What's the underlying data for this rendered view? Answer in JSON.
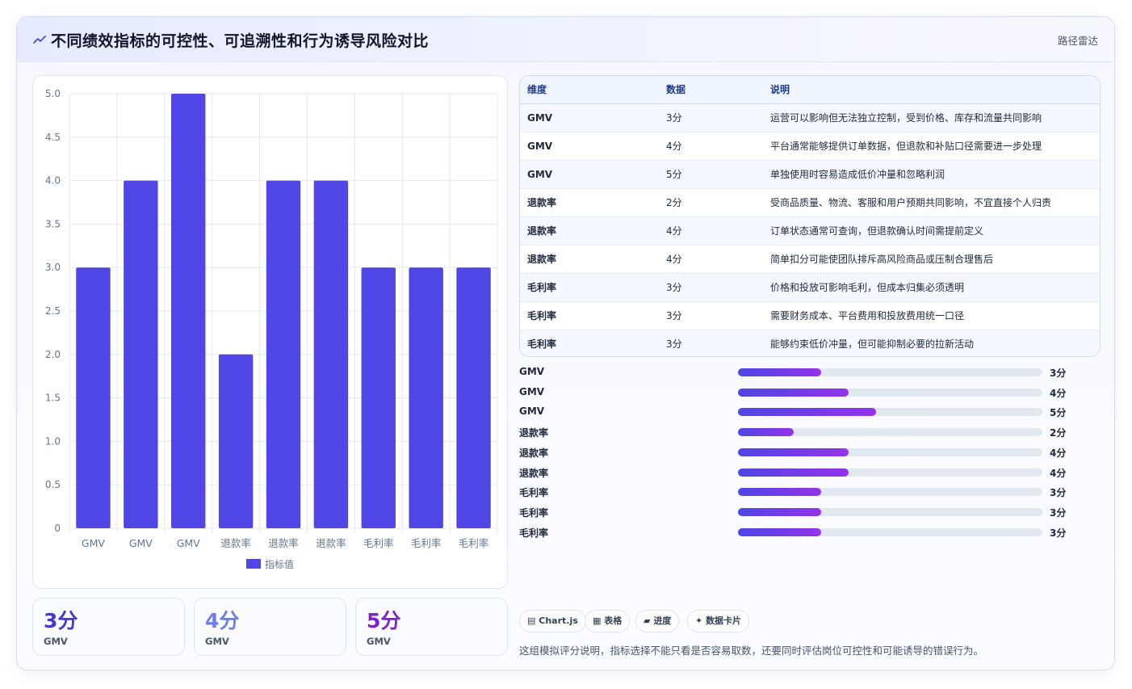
{
  "header": {
    "title": "不同绩效指标的可控性、可追溯性和行为诱导风险对比",
    "tag": "路径雷达"
  },
  "colors": {
    "bar": "#4f46e5",
    "stat": [
      "#4338ca",
      "#6d7fe6",
      "#7e22ce"
    ]
  },
  "chart_data": {
    "type": "bar",
    "categories": [
      "GMV",
      "GMV",
      "GMV",
      "退款率",
      "退款率",
      "退款率",
      "毛利率",
      "毛利率",
      "毛利率"
    ],
    "series": [
      {
        "name": "指标值",
        "values": [
          3,
          4,
          5,
          2,
          4,
          4,
          3,
          3,
          3
        ]
      }
    ],
    "ylim": [
      0,
      5
    ],
    "yticks": [
      "0",
      "0.5",
      "1.0",
      "1.5",
      "2.0",
      "2.5",
      "3.0",
      "3.5",
      "4.0",
      "4.5",
      "5.0"
    ],
    "grid": true,
    "legend": "bottom"
  },
  "stats": [
    {
      "value": "3分",
      "label": "GMV"
    },
    {
      "value": "4分",
      "label": "GMV"
    },
    {
      "value": "5分",
      "label": "GMV"
    }
  ],
  "table": {
    "headers": [
      "维度",
      "数据",
      "说明"
    ],
    "rows": [
      {
        "dim": "GMV",
        "score": "3分",
        "note": "运营可以影响但无法独立控制，受到价格、库存和流量共同影响"
      },
      {
        "dim": "GMV",
        "score": "4分",
        "note": "平台通常能够提供订单数据，但退款和补贴口径需要进一步处理"
      },
      {
        "dim": "GMV",
        "score": "5分",
        "note": "单独使用时容易造成低价冲量和忽略利润"
      },
      {
        "dim": "退款率",
        "score": "2分",
        "note": "受商品质量、物流、客服和用户预期共同影响，不宜直接个人归责"
      },
      {
        "dim": "退款率",
        "score": "4分",
        "note": "订单状态通常可查询，但退款确认时间需提前定义"
      },
      {
        "dim": "退款率",
        "score": "4分",
        "note": "简单扣分可能使团队排斥高风险商品或压制合理售后"
      },
      {
        "dim": "毛利率",
        "score": "3分",
        "note": "价格和投放可影响毛利，但成本归集必须透明"
      },
      {
        "dim": "毛利率",
        "score": "3分",
        "note": "需要财务成本、平台费用和投放费用统一口径"
      },
      {
        "dim": "毛利率",
        "score": "3分",
        "note": "能够约束低价冲量，但可能抑制必要的拉新活动"
      }
    ]
  },
  "progress": {
    "max": 11,
    "items": [
      {
        "label": "GMV",
        "value": 3,
        "text": "3分"
      },
      {
        "label": "GMV",
        "value": 4,
        "text": "4分"
      },
      {
        "label": "GMV",
        "value": 5,
        "text": "5分"
      },
      {
        "label": "退款率",
        "value": 2,
        "text": "2分"
      },
      {
        "label": "退款率",
        "value": 4,
        "text": "4分"
      },
      {
        "label": "退款率",
        "value": 4,
        "text": "4分"
      },
      {
        "label": "毛利率",
        "value": 3,
        "text": "3分"
      },
      {
        "label": "毛利率",
        "value": 3,
        "text": "3分"
      },
      {
        "label": "毛利率",
        "value": 3,
        "text": "3分"
      }
    ]
  },
  "chips": [
    {
      "label": "Chart.js",
      "icon": "chart-icon"
    },
    {
      "label": "表格",
      "icon": "table-icon"
    },
    {
      "label": "进度",
      "icon": "progress-icon"
    },
    {
      "label": "数据卡片",
      "icon": "sparkle-icon"
    }
  ],
  "footnote": "这组模拟评分说明，指标选择不能只看是否容易取数，还要同时评估岗位可控性和可能诱导的错误行为。"
}
